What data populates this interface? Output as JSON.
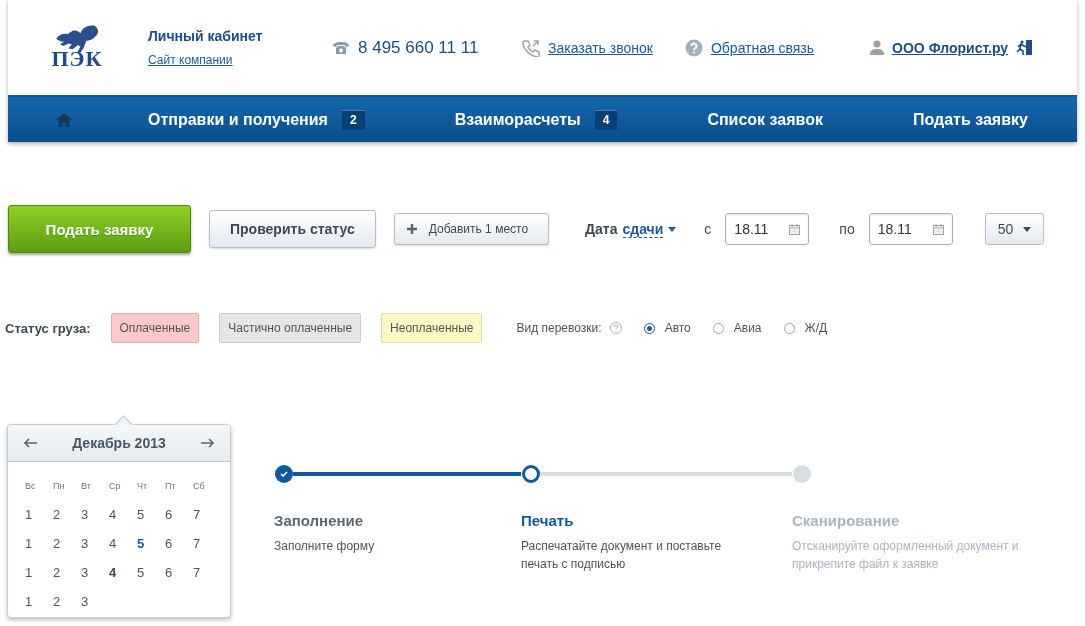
{
  "header": {
    "logo_text": "ПЭК",
    "cabinet_title": "Личный кабинет",
    "company_link": "Сайт компании",
    "phone": "8 495 660 11 11",
    "callback_link": "Заказать звонок",
    "feedback_link": "Обратная связь",
    "user_link": "ООО Флорист.ру"
  },
  "nav": [
    {
      "kind": "home"
    },
    {
      "kind": "link",
      "label": "Отправки и получения",
      "badge": "2"
    },
    {
      "kind": "link",
      "label": "Взаиморасчеты",
      "badge": "4"
    },
    {
      "kind": "link",
      "label": "Список заявок"
    },
    {
      "kind": "link",
      "label": "Подать заявку"
    }
  ],
  "toolbar": {
    "primary_button": "Подать заявку",
    "status_button": "Проверить статус",
    "add_button": "Добавить 1 место",
    "date_label": "Дата",
    "date_type": "сдачи",
    "from_label": "с",
    "date_from": "18.11",
    "to_label": "по",
    "date_to": "18.11",
    "page_size": "50"
  },
  "filters": {
    "status_label": "Статус груза:",
    "statuses": [
      {
        "label": "Оплаченные",
        "color": "#ffc9c9"
      },
      {
        "label": "Частично оплаченные",
        "color": "#e6e6e6"
      },
      {
        "label": "Неоплаченные",
        "color": "#fff8c4"
      }
    ],
    "transport_label": "Вид перевозки:",
    "transport_options": [
      {
        "label": "Авто",
        "selected": true
      },
      {
        "label": "Авиа",
        "selected": false
      },
      {
        "label": "Ж/Д",
        "selected": false
      }
    ]
  },
  "calendar": {
    "month": "Декабрь 2013",
    "weekdays": [
      "Вс",
      "Пн",
      "Вт",
      "Ср",
      "Чт",
      "Пт",
      "Сб"
    ],
    "weeks": [
      [
        {
          "day": "1",
          "kind": "normal"
        },
        {
          "day": "2",
          "kind": "normal"
        },
        {
          "day": "3",
          "kind": "normal"
        },
        {
          "day": "4",
          "kind": "normal"
        },
        {
          "day": "5",
          "kind": "normal"
        },
        {
          "day": "6",
          "kind": "normal"
        },
        {
          "day": "7",
          "kind": "normal"
        }
      ],
      [
        {
          "day": "1",
          "kind": "normal"
        },
        {
          "day": "2",
          "kind": "normal"
        },
        {
          "day": "3",
          "kind": "normal"
        },
        {
          "day": "4",
          "kind": "normal"
        },
        {
          "day": "5",
          "kind": "today"
        },
        {
          "day": "6",
          "kind": "normal"
        },
        {
          "day": "7",
          "kind": "normal"
        }
      ],
      [
        {
          "day": "1",
          "kind": "normal"
        },
        {
          "day": "2",
          "kind": "normal"
        },
        {
          "day": "3",
          "kind": "normal"
        },
        {
          "day": "4",
          "kind": "marked"
        },
        {
          "day": "5",
          "kind": "normal"
        },
        {
          "day": "6",
          "kind": "normal"
        },
        {
          "day": "7",
          "kind": "normal"
        }
      ],
      [
        {
          "day": "1",
          "kind": "normal"
        },
        {
          "day": "2",
          "kind": "normal"
        },
        {
          "day": "3",
          "kind": "normal"
        }
      ]
    ]
  },
  "steps": [
    {
      "title": "Заполнение",
      "text": "Заполните форму",
      "completed": true,
      "active": false
    },
    {
      "title": "Печать",
      "text": "Распечатайте документ и поставьте печать с подписью",
      "completed": false,
      "active": true
    },
    {
      "title": "Сканирование",
      "text": "Отсканируйте оформленный документ и прикрепите файл к заявке",
      "completed": false,
      "active": false
    }
  ]
}
